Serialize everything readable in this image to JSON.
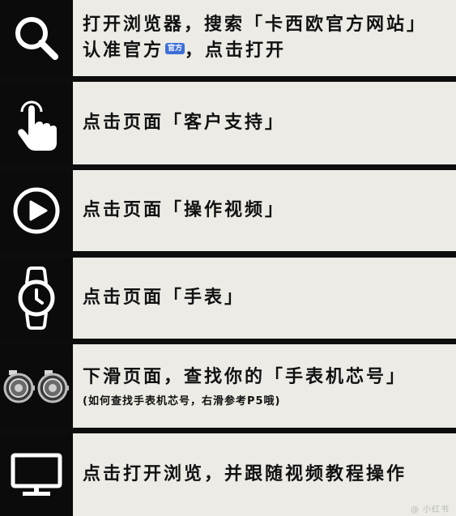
{
  "steps": [
    {
      "icon": "search-icon",
      "line1": "打开浏览器，搜索「卡西欧官方网站」",
      "line2_prefix": "认准官方",
      "badge": "官方",
      "line2_suffix": "，点击打开"
    },
    {
      "icon": "tap-hand-icon",
      "text": "点击页面「客户支持」"
    },
    {
      "icon": "play-circle-icon",
      "text": "点击页面「操作视频」"
    },
    {
      "icon": "watch-icon",
      "text": "点击页面「手表」"
    },
    {
      "icon": "watch-caseback-icon",
      "text": "下滑页面，查找你的「手表机芯号」",
      "subtext": "(如何查找手表机芯号，右滑参考P5哦)"
    },
    {
      "icon": "monitor-icon",
      "text": "点击打开浏览，并跟随视频教程操作"
    }
  ],
  "watermark": "@ 小红书"
}
